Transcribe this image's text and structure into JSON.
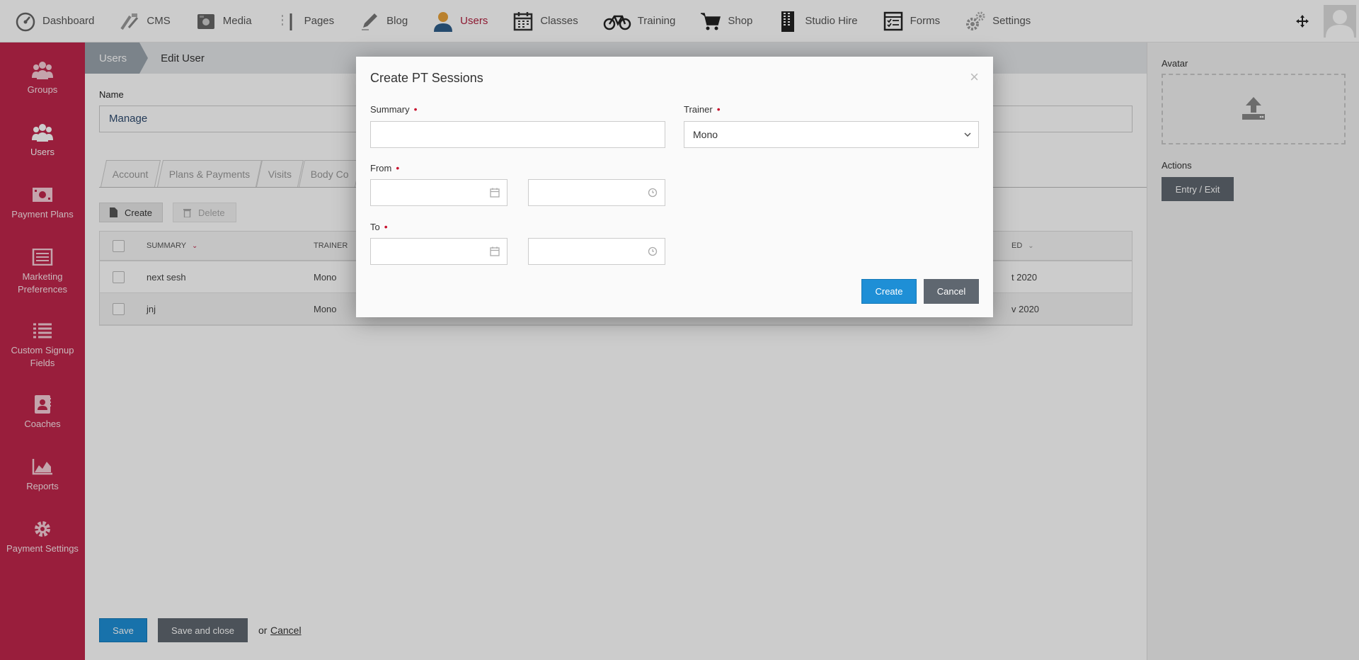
{
  "topnav": {
    "items": [
      {
        "label": "Dashboard",
        "icon": "dashboard-icon"
      },
      {
        "label": "CMS",
        "icon": "cms-icon"
      },
      {
        "label": "Media",
        "icon": "media-icon"
      },
      {
        "label": "Pages",
        "icon": "pages-icon"
      },
      {
        "label": "Blog",
        "icon": "blog-icon"
      },
      {
        "label": "Users",
        "icon": "user-icon",
        "active": true
      },
      {
        "label": "Classes",
        "icon": "calendar-icon"
      },
      {
        "label": "Training",
        "icon": "bicycle-icon"
      },
      {
        "label": "Shop",
        "icon": "cart-icon"
      },
      {
        "label": "Studio Hire",
        "icon": "building-icon"
      },
      {
        "label": "Forms",
        "icon": "forms-icon"
      },
      {
        "label": "Settings",
        "icon": "gears-icon"
      }
    ]
  },
  "sidebar": {
    "items": [
      {
        "label": "Groups",
        "icon": "groups-icon"
      },
      {
        "label": "Users",
        "icon": "users-icon",
        "active": true
      },
      {
        "label": "Payment Plans",
        "icon": "money-icon"
      },
      {
        "label": "Marketing Preferences",
        "icon": "newspaper-icon"
      },
      {
        "label": "Custom Signup Fields",
        "icon": "list-icon"
      },
      {
        "label": "Coaches",
        "icon": "contact-icon"
      },
      {
        "label": "Reports",
        "icon": "area-chart-icon"
      },
      {
        "label": "Payment Settings",
        "icon": "gear-icon"
      }
    ]
  },
  "breadcrumb": {
    "root": "Users",
    "current": "Edit User"
  },
  "form": {
    "name_label": "Name",
    "name_value": "Manage"
  },
  "tabs": [
    "Account",
    "Plans & Payments",
    "Visits",
    "Body Co"
  ],
  "toolbar": {
    "create": "Create",
    "delete": "Delete"
  },
  "table": {
    "headers": {
      "summary": "SUMMARY",
      "trainer": "TRAINER",
      "right_partial": "ED"
    },
    "rows": [
      {
        "summary": "next sesh",
        "trainer": "Mono",
        "right_partial": "t 2020"
      },
      {
        "summary": "jnj",
        "trainer": "Mono",
        "right_partial": "v 2020"
      }
    ]
  },
  "footer": {
    "save": "Save",
    "save_close": "Save and close",
    "or": "or",
    "cancel": "Cancel"
  },
  "rightpanel": {
    "avatar_label": "Avatar",
    "actions_label": "Actions",
    "entry_exit": "Entry / Exit"
  },
  "modal": {
    "title": "Create PT Sessions",
    "summary_label": "Summary",
    "summary_value": "",
    "trainer_label": "Trainer",
    "trainer_value": "Mono",
    "from_label": "From",
    "to_label": "To",
    "create": "Create",
    "cancel": "Cancel",
    "required_mark": "•"
  },
  "colors": {
    "brand": "#c0264b",
    "primary": "#1e8fd6",
    "secondary": "#5f6770",
    "active_nav": "#b1213f"
  }
}
